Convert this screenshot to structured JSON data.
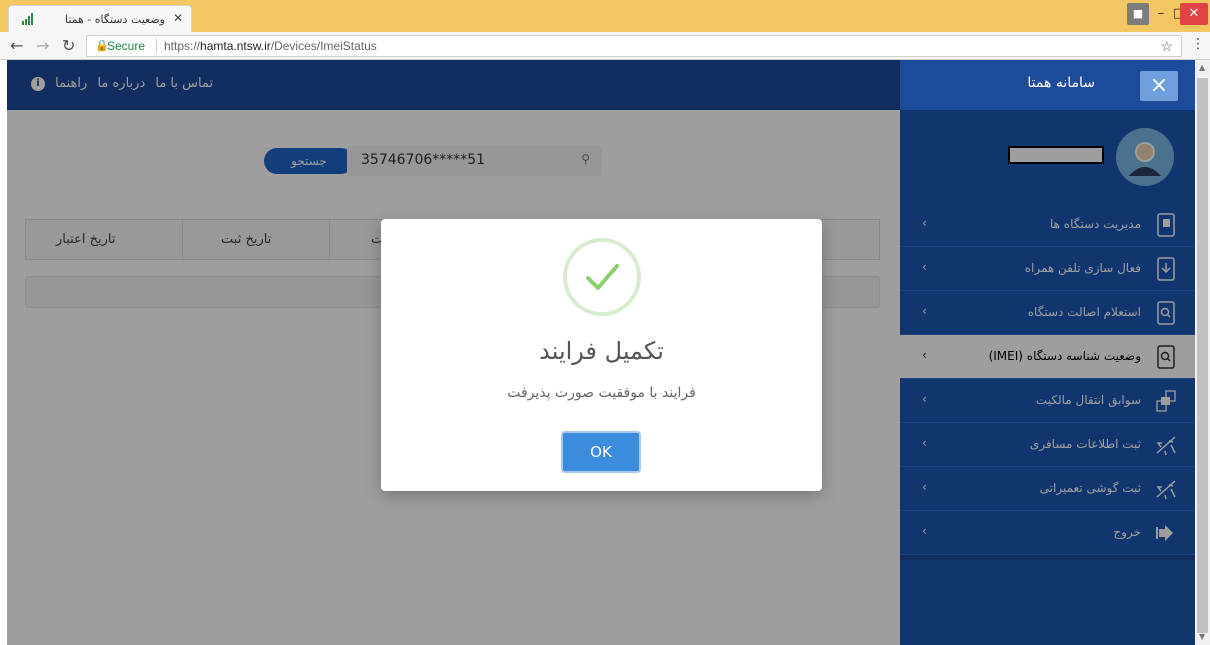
{
  "browser": {
    "tab_title": "وضعیت دستگاه - همتا",
    "secure_label": "Secure",
    "url_scheme": "https://",
    "url_host": "hamta.ntsw.ir",
    "url_path": "/Devices/ImeiStatus"
  },
  "topnav": {
    "links": [
      "تماس با ما",
      "درباره ما",
      "راهنما"
    ]
  },
  "search": {
    "value": "35746706*****51",
    "button_label": "جستجو"
  },
  "table": {
    "headers": [
      "تاریخ اعتبار",
      "تاریخ ثبت",
      "ت"
    ]
  },
  "sidebar": {
    "brand": "سامانه همتا",
    "items": [
      {
        "label": "مدیریت دستگاه ها",
        "icon": "device-manage-icon"
      },
      {
        "label": "فعال سازی تلفن همراه",
        "icon": "phone-activate-icon"
      },
      {
        "label": "استعلام اصالت دستگاه",
        "icon": "device-inquiry-icon"
      },
      {
        "label": "وضعیت شناسه دستگاه (IMEI)",
        "icon": "imei-status-icon",
        "active": true
      },
      {
        "label": "سوابق انتقال مالکیت",
        "icon": "ownership-transfer-icon"
      },
      {
        "label": "ثبت اطلاعات مسافری",
        "icon": "airplane-icon"
      },
      {
        "label": "ثبت گوشی تعمیراتی",
        "icon": "airplane-icon"
      },
      {
        "label": "خروج",
        "icon": "logout-icon"
      }
    ]
  },
  "dialog": {
    "title": "تکمیل فرایند",
    "message": "فرایند با موفقیت صورت پذیرفت",
    "ok_label": "OK",
    "icon": "success-check-icon"
  },
  "colors": {
    "primary": "#1d4b9b",
    "sidebar_item": "#1a56b3",
    "button": "#3b8cdc",
    "success": "#8bcf6f"
  }
}
